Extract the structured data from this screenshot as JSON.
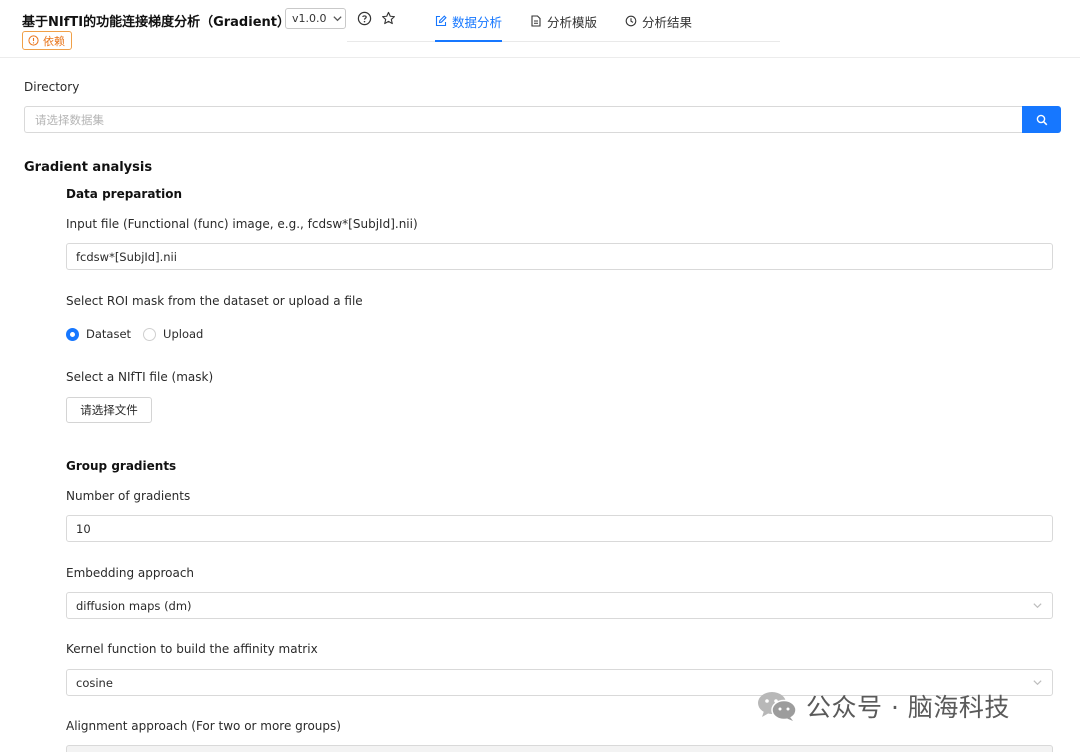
{
  "header": {
    "title": "基于NIfTI的功能连接梯度分析（Gradient）",
    "version": "v1.0.0",
    "badge": "依赖",
    "tabs": [
      {
        "label": "数据分析",
        "icon": "edit-icon",
        "active": true
      },
      {
        "label": "分析模版",
        "icon": "document-icon",
        "active": false
      },
      {
        "label": "分析结果",
        "icon": "history-icon",
        "active": false
      }
    ]
  },
  "directory": {
    "label": "Directory",
    "placeholder": "请选择数据集"
  },
  "gradient": {
    "title": "Gradient analysis",
    "data_prep": {
      "title": "Data preparation",
      "input_label": "Input file (Functional (func) image, e.g., fcdsw*[SubjId].nii)",
      "input_value": "fcdsw*[SubjId].nii",
      "roi_label": "Select ROI mask from the dataset or upload a file",
      "radio_dataset": "Dataset",
      "radio_upload": "Upload",
      "nifti_label": "Select a NIfTI file (mask)",
      "file_button": "请选择文件"
    },
    "group": {
      "title": "Group gradients",
      "num_label": "Number of gradients",
      "num_value": "10",
      "embed_label": "Embedding approach",
      "embed_value": "diffusion maps (dm)",
      "kernel_label": "Kernel function to build the affinity matrix",
      "kernel_value": "cosine",
      "align_label": "Alignment approach (For two or more groups)"
    }
  },
  "watermark": "公众号 · 脑海科技",
  "colors": {
    "accent": "#1677ff",
    "badge": "#e8741a"
  }
}
